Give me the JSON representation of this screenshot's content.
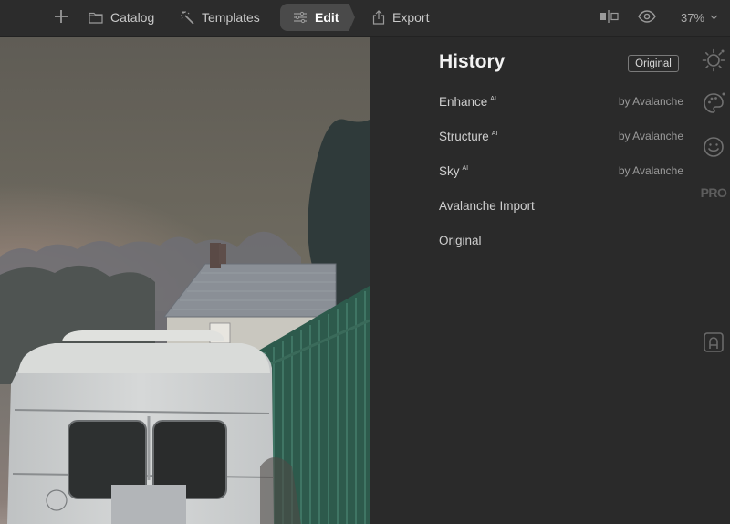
{
  "topbar": {
    "add_icon": "plus-icon",
    "catalog_label": "Catalog",
    "templates_label": "Templates",
    "edit_label": "Edit",
    "export_label": "Export",
    "zoom_level": "37%",
    "compare_icon": "split-compare-icon",
    "preview_icon": "eye-icon"
  },
  "history": {
    "title": "History",
    "original_button": "Original",
    "items": [
      {
        "name": "Enhance",
        "badge": "AI",
        "by": "by Avalanche"
      },
      {
        "name": "Structure",
        "badge": "AI",
        "by": "by Avalanche"
      },
      {
        "name": "Sky",
        "badge": "AI",
        "by": "by Avalanche"
      },
      {
        "name": "Avalanche Import",
        "badge": "",
        "by": ""
      },
      {
        "name": "Original",
        "badge": "",
        "by": ""
      }
    ]
  },
  "tool_rail": {
    "items": [
      {
        "icon": "sun-icon",
        "label": "Essentials"
      },
      {
        "icon": "palette-icon",
        "label": "Creative"
      },
      {
        "icon": "smiley-icon",
        "label": "Portrait"
      },
      {
        "icon": "pro-label",
        "label": "PRO"
      },
      {
        "icon": "framed-a-icon",
        "label": "Local masking"
      }
    ]
  },
  "colors": {
    "background": "#2a2a2a",
    "topbar": "#2c2c2c",
    "active_tab": "#4a4a4a",
    "text_primary": "#f2f2f2",
    "text_secondary": "#9a9a9a"
  }
}
